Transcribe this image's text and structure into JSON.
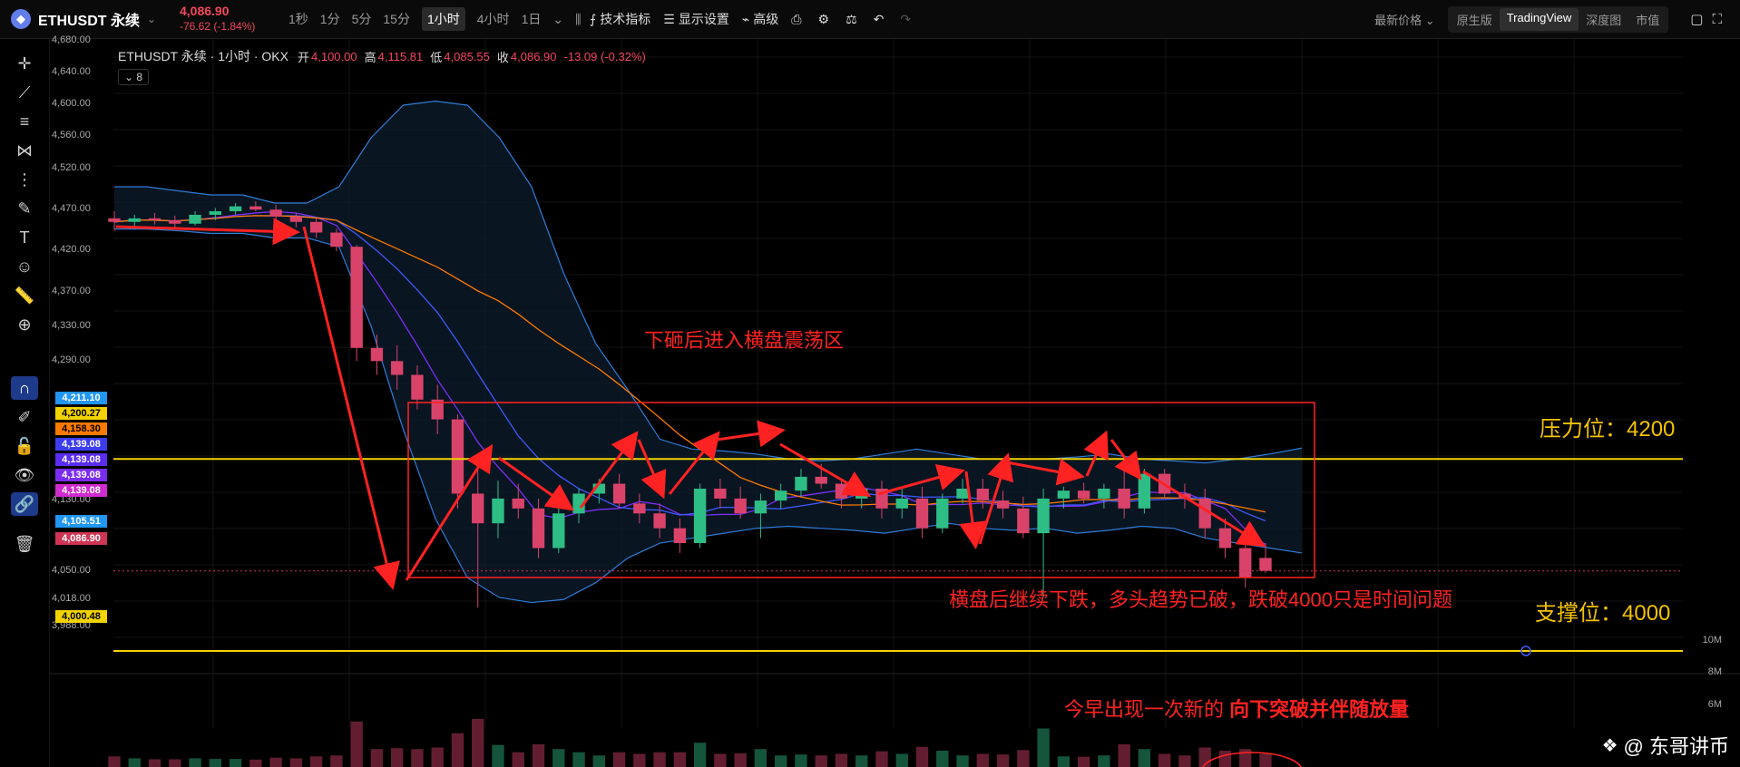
{
  "header": {
    "symbol": "ETHUSDT 永续",
    "last_price": "4,086.90",
    "change": "-76.62 (-1.84%)",
    "intervals": [
      "1秒",
      "1分",
      "5分",
      "15分",
      "1小时",
      "4小时",
      "1日"
    ],
    "active_interval": "1小时",
    "tools": [
      "技术指标",
      "显示设置",
      "高级"
    ],
    "latest_price_label": "最新价格",
    "views": [
      "原生版",
      "TradingView",
      "深度图",
      "市值"
    ],
    "active_view": "TradingView"
  },
  "legend": {
    "title": "ETHUSDT 永续 · 1小时 · OKX",
    "open_k": "开",
    "open_v": "4,100.00",
    "high_k": "高",
    "high_v": "4,115.81",
    "low_k": "低",
    "low_v": "4,085.55",
    "close_k": "收",
    "close_v": "4,086.90",
    "change": "-13.09 (-0.32%)",
    "indicator_count": "8"
  },
  "y_axis_labels": [
    "4,680.00",
    "4,640.00",
    "4,600.00",
    "4,560.00",
    "4,520.00",
    "4,470.00",
    "4,420.00",
    "4,370.00",
    "4,330.00",
    "4,290.00",
    "4,130.00",
    "4,050.00",
    "4,018.00",
    "3,988.00"
  ],
  "price_tags": [
    {
      "text": "4,211.10",
      "color": "#2196f3"
    },
    {
      "text": "4,200.27",
      "color": "#f2d300"
    },
    {
      "text": "4,158.30",
      "color": "#ff7a00"
    },
    {
      "text": "4,139.08",
      "color": "#3d3df0"
    },
    {
      "text": "4,139.08",
      "color": "#5a2df0"
    },
    {
      "text": "4,139.08",
      "color": "#7a2df0"
    },
    {
      "text": "4,139.08",
      "color": "#d02ad0"
    },
    {
      "text": "4,105.51",
      "color": "#2196f3"
    },
    {
      "text": "4,086.90",
      "color": "#cf3555"
    },
    {
      "text": "4,000.48",
      "color": "#f2d300"
    }
  ],
  "volume_labels": [
    "10M",
    "8M",
    "6M"
  ],
  "annotations": {
    "range_note": "下砸后进入横盘震荡区",
    "resistance": "压力位：4200",
    "support": "支撑位：4000",
    "breakdown_note": "横盘后继续下跌，多头趋势已破，跌破4000只是时间问题",
    "volume_note_plain": "今早出现一次新的 ",
    "volume_note_bold": "向下突破并伴随放量"
  },
  "watermark": "@ 东哥讲币",
  "colors": {
    "up": "#2ebd85",
    "down": "#d9436a",
    "support": "#f2d300",
    "annot": "#ff2222",
    "bb": "#2f7cd8"
  },
  "chart_data": {
    "type": "candlestick",
    "title": "ETHUSDT 永续 · 1小时 · OKX",
    "ylim": [
      3988,
      4680
    ],
    "resistance": 4200,
    "support": 4000,
    "candles_ohlc": [
      [
        4462,
        4470,
        4448,
        4458
      ],
      [
        4458,
        4466,
        4450,
        4462
      ],
      [
        4462,
        4468,
        4455,
        4460
      ],
      [
        4460,
        4465,
        4452,
        4456
      ],
      [
        4456,
        4470,
        4454,
        4466
      ],
      [
        4466,
        4474,
        4460,
        4470
      ],
      [
        4470,
        4480,
        4466,
        4476
      ],
      [
        4476,
        4482,
        4470,
        4472
      ],
      [
        4472,
        4478,
        4460,
        4464
      ],
      [
        4464,
        4468,
        4452,
        4458
      ],
      [
        4458,
        4462,
        4440,
        4446
      ],
      [
        4446,
        4450,
        4425,
        4430
      ],
      [
        4430,
        4432,
        4300,
        4315
      ],
      [
        4315,
        4330,
        4285,
        4300
      ],
      [
        4300,
        4318,
        4270,
        4285
      ],
      [
        4285,
        4295,
        4250,
        4260
      ],
      [
        4260,
        4275,
        4225,
        4240
      ],
      [
        4240,
        4245,
        4150,
        4165
      ],
      [
        4165,
        4190,
        4050,
        4135
      ],
      [
        4135,
        4178,
        4120,
        4160
      ],
      [
        4160,
        4175,
        4140,
        4150
      ],
      [
        4150,
        4160,
        4100,
        4110
      ],
      [
        4110,
        4150,
        4105,
        4145
      ],
      [
        4145,
        4170,
        4135,
        4165
      ],
      [
        4165,
        4180,
        4155,
        4175
      ],
      [
        4175,
        4185,
        4150,
        4155
      ],
      [
        4155,
        4165,
        4135,
        4145
      ],
      [
        4145,
        4155,
        4120,
        4130
      ],
      [
        4130,
        4140,
        4105,
        4115
      ],
      [
        4115,
        4175,
        4110,
        4170
      ],
      [
        4170,
        4180,
        4150,
        4160
      ],
      [
        4160,
        4172,
        4140,
        4145
      ],
      [
        4145,
        4165,
        4120,
        4158
      ],
      [
        4158,
        4175,
        4150,
        4168
      ],
      [
        4168,
        4190,
        4162,
        4182
      ],
      [
        4182,
        4195,
        4170,
        4175
      ],
      [
        4175,
        4180,
        4150,
        4160
      ],
      [
        4160,
        4175,
        4150,
        4170
      ],
      [
        4170,
        4178,
        4140,
        4150
      ],
      [
        4150,
        4170,
        4140,
        4160
      ],
      [
        4160,
        4172,
        4120,
        4130
      ],
      [
        4130,
        4165,
        4125,
        4160
      ],
      [
        4160,
        4180,
        4155,
        4170
      ],
      [
        4170,
        4180,
        4150,
        4158
      ],
      [
        4158,
        4168,
        4140,
        4150
      ],
      [
        4150,
        4162,
        4120,
        4125
      ],
      [
        4125,
        4170,
        4060,
        4160
      ],
      [
        4160,
        4172,
        4150,
        4168
      ],
      [
        4168,
        4176,
        4155,
        4160
      ],
      [
        4160,
        4175,
        4150,
        4170
      ],
      [
        4170,
        4200,
        4140,
        4150
      ],
      [
        4150,
        4190,
        4145,
        4185
      ],
      [
        4185,
        4190,
        4160,
        4165
      ],
      [
        4165,
        4175,
        4150,
        4160
      ],
      [
        4160,
        4170,
        4120,
        4130
      ],
      [
        4130,
        4140,
        4100,
        4110
      ],
      [
        4110,
        4115,
        4070,
        4080
      ],
      [
        4100,
        4115,
        4085,
        4087
      ]
    ]
  }
}
